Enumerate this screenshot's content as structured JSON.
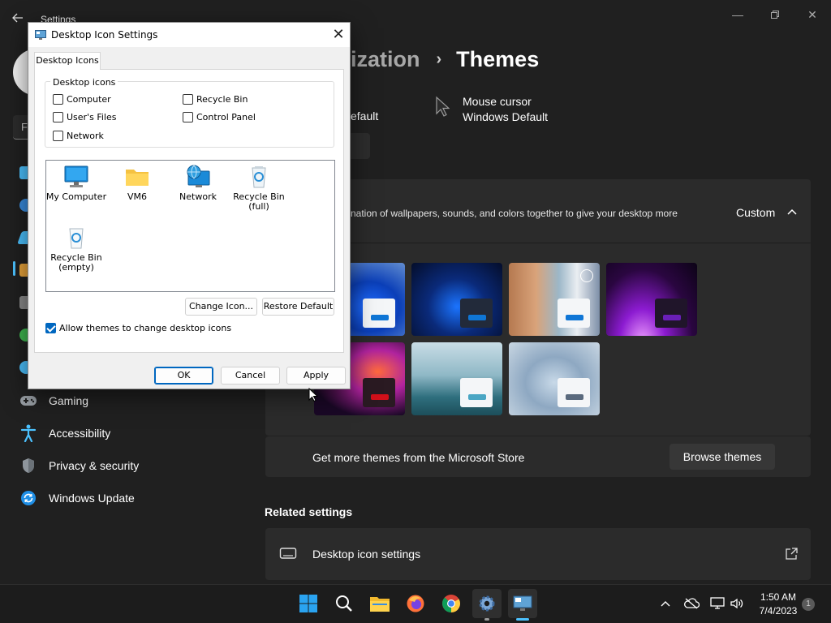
{
  "settings": {
    "app_title": "Settings",
    "breadcrumb": {
      "parent": "ization",
      "separator": "›",
      "current": "Themes"
    },
    "font_value_fragment": "efault",
    "mouse_cursor": {
      "title": "Mouse cursor",
      "value": "Windows Default"
    },
    "current_theme": {
      "description_fragment": "nation of wallpapers, sounds, and colors together to give your desktop more",
      "value": "Custom"
    },
    "themes": [
      {
        "accent": "#0f76d6"
      },
      {
        "accent": "#0f76d6"
      },
      {
        "accent": "#0f76d6"
      },
      {
        "accent": "#6a1fb8"
      },
      {
        "accent": "#d1101a"
      },
      {
        "accent": "#4aa6c4"
      },
      {
        "accent": "#5a6a7e"
      }
    ],
    "store_text": "Get more themes from the Microsoft Store",
    "browse_label": "Browse themes",
    "related_heading": "Related settings",
    "related_item": "Desktop icon settings",
    "nav": [
      {
        "label": "Gaming",
        "icon": "gamepad-icon"
      },
      {
        "label": "Accessibility",
        "icon": "accessibility-icon"
      },
      {
        "label": "Privacy & security",
        "icon": "shield-icon"
      },
      {
        "label": "Windows Update",
        "icon": "update-icon"
      }
    ]
  },
  "dialog": {
    "title": "Desktop Icon Settings",
    "tab": "Desktop Icons",
    "group_label": "Desktop icons",
    "checkboxes": {
      "computer": {
        "label": "Computer",
        "checked": false
      },
      "user_files": {
        "label": "User's Files",
        "checked": false
      },
      "network": {
        "label": "Network",
        "checked": false
      },
      "recycle_bin": {
        "label": "Recycle Bin",
        "checked": false
      },
      "control_panel": {
        "label": "Control Panel",
        "checked": false
      }
    },
    "icons": [
      {
        "label": "My Computer"
      },
      {
        "label": "VM6"
      },
      {
        "label": "Network"
      },
      {
        "label": "Recycle Bin (full)"
      },
      {
        "label": "Recycle Bin (empty)"
      }
    ],
    "change_icon": "Change Icon...",
    "restore_default": "Restore Default",
    "allow_themes": {
      "label": "Allow themes to change desktop icons",
      "checked": true
    },
    "ok": "OK",
    "cancel": "Cancel",
    "apply": "Apply"
  },
  "taskbar": {
    "apps": [
      "start-icon",
      "search-icon",
      "file-explorer-icon",
      "firefox-icon",
      "chrome-icon",
      "settings-icon",
      "desktop-icon-settings-icon"
    ],
    "time": "1:50 AM",
    "date": "7/4/2023",
    "notification_count": "1"
  }
}
